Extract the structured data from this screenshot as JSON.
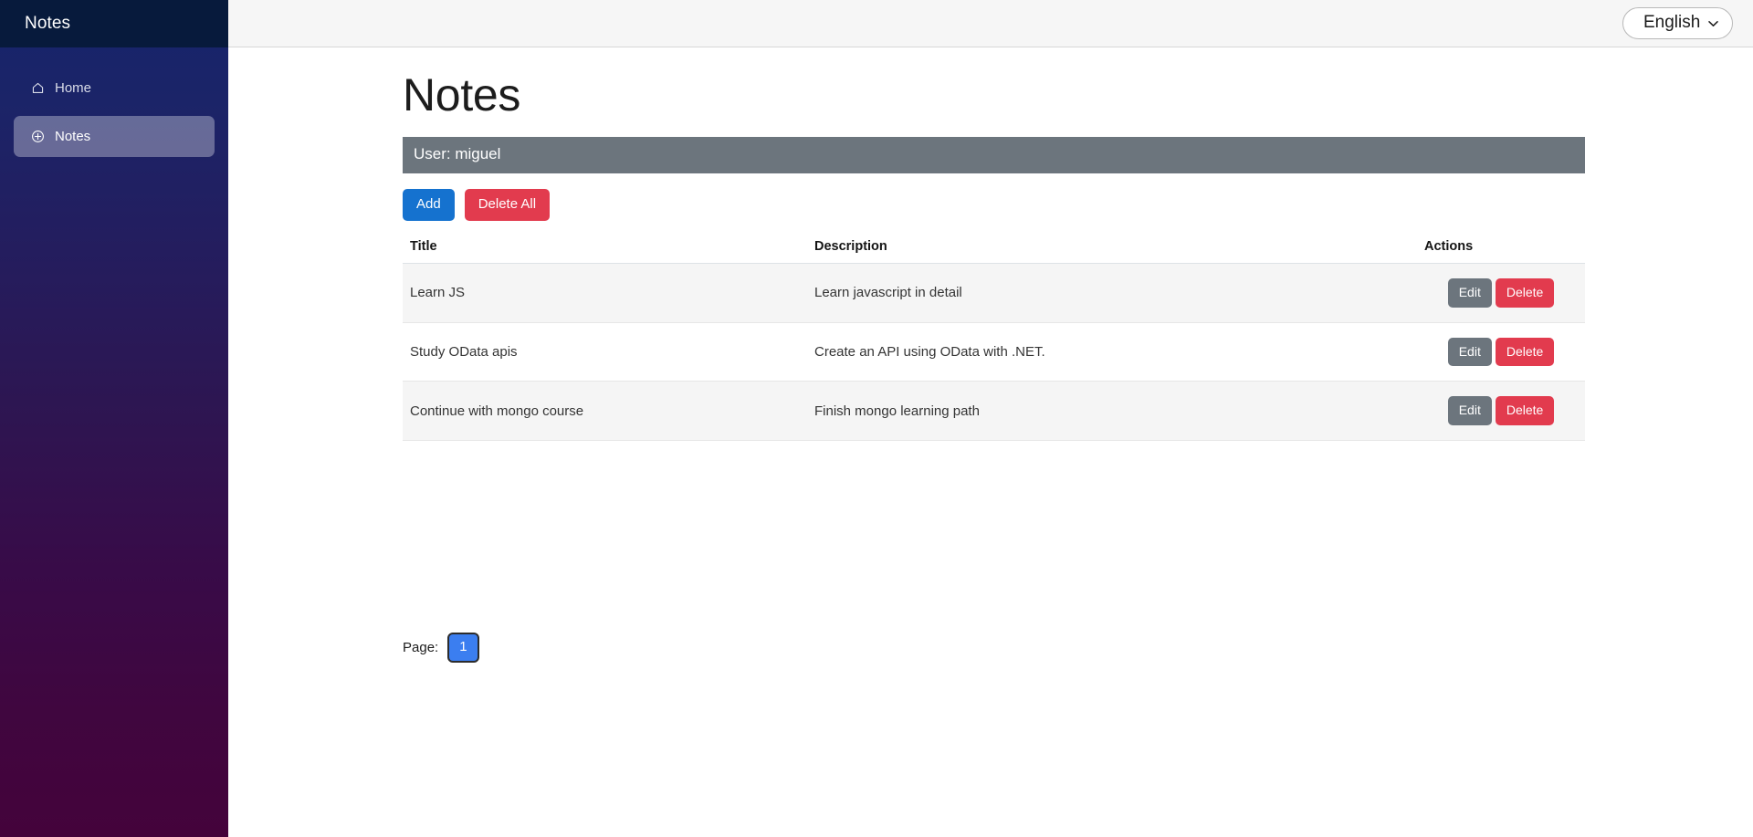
{
  "sidebar": {
    "brand": "Notes",
    "items": [
      {
        "label": "Home",
        "icon": "home-icon",
        "active": false
      },
      {
        "label": "Notes",
        "icon": "plus-circle-icon",
        "active": true
      }
    ]
  },
  "topbar": {
    "language": {
      "selected": "English",
      "options": [
        "English"
      ],
      "caret_icon": "chevron-down-icon"
    }
  },
  "main": {
    "page_title": "Notes",
    "user_banner": "User: miguel",
    "actions": {
      "add_label": "Add",
      "delete_all_label": "Delete All"
    },
    "table": {
      "columns": [
        "Title",
        "Description",
        "Actions"
      ],
      "row_actions": {
        "edit_label": "Edit",
        "delete_label": "Delete"
      },
      "rows": [
        {
          "title": "Learn JS",
          "description": "Learn javascript in detail"
        },
        {
          "title": "Study OData apis",
          "description": "Create an API using OData with .NET."
        },
        {
          "title": "Continue with mongo course",
          "description": "Finish mongo learning path"
        }
      ]
    },
    "pagination": {
      "label": "Page:",
      "pages": [
        "1"
      ],
      "current": "1"
    }
  },
  "colors": {
    "sidebar_top": "#16256b",
    "sidebar_bottom": "#44033b",
    "sidebar_header": "#071a3c",
    "banner": "#6c757d",
    "primary": "#1572cf",
    "danger": "#e23b4e",
    "secondary": "#6c757d",
    "page_active": "#3b7ef0"
  }
}
